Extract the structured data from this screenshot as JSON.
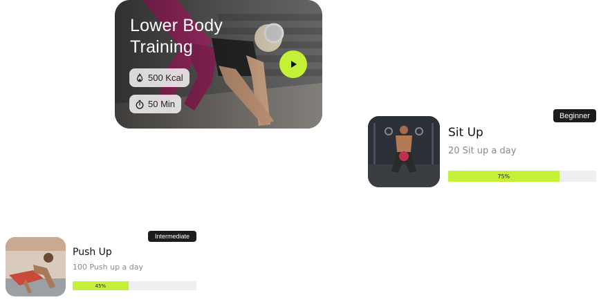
{
  "feature": {
    "title_line1": "Lower Body",
    "title_line2": "Training",
    "calories": "500 Kcal",
    "duration": "50 Min",
    "accent": "#c5f038",
    "icons": {
      "calories": "flame-icon",
      "duration": "stopwatch-icon",
      "play": "play-icon"
    }
  },
  "workouts": [
    {
      "level": "Beginner",
      "name": "Sit Up",
      "subtitle": "20 Sit up a day",
      "progress_label": "75%",
      "progress": 0.75
    },
    {
      "level": "Intermediate",
      "name": "Push Up",
      "subtitle": "100 Push up a day",
      "progress_label": "45%",
      "progress": 0.45
    }
  ]
}
